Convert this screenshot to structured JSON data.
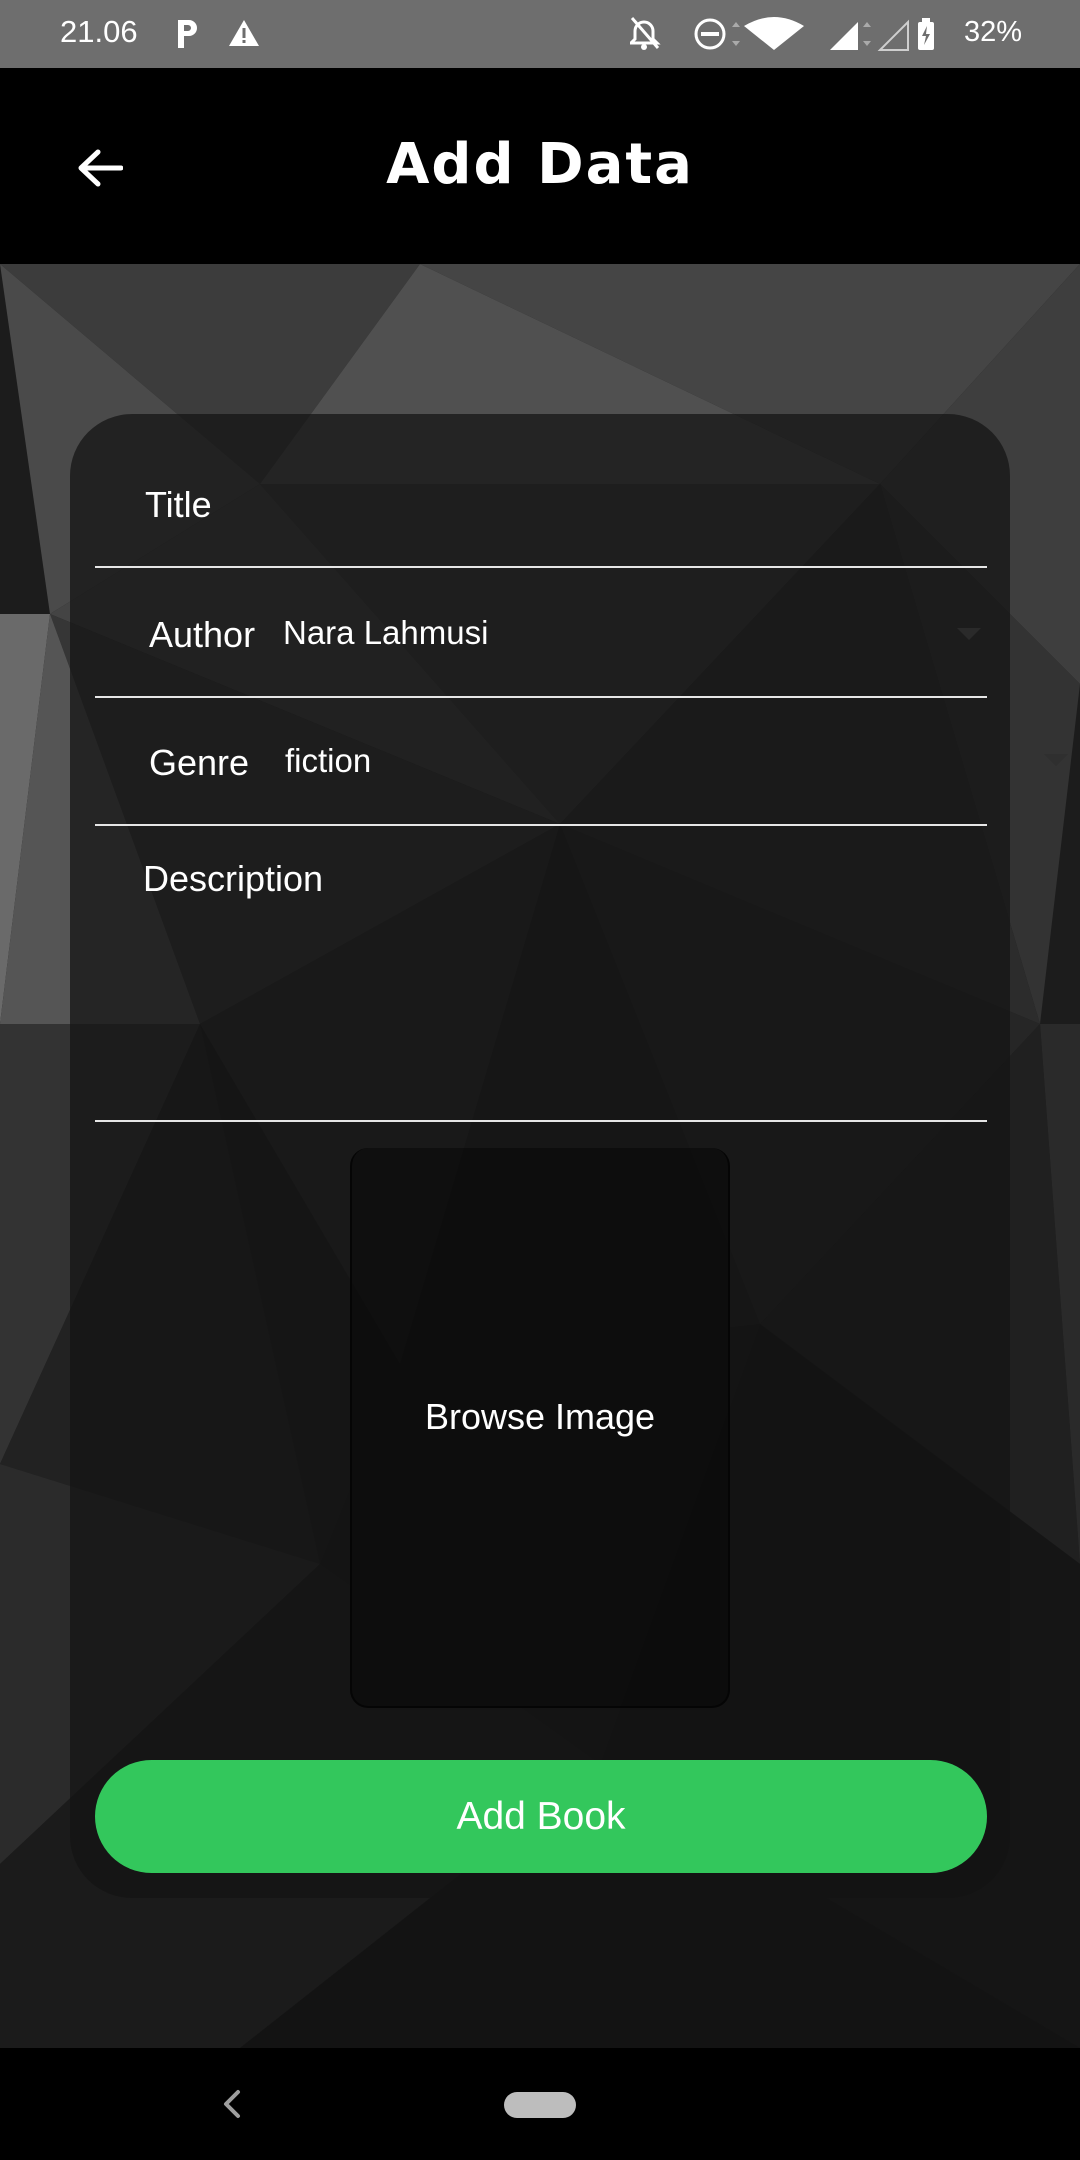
{
  "status_bar": {
    "time": "21.06",
    "battery_percent": "32%",
    "icons": [
      "parking-app-icon",
      "warning-icon",
      "notifications-off-icon",
      "do-not-disturb-icon",
      "wifi-icon",
      "signal-icon",
      "signal-empty-icon",
      "battery-charging-icon"
    ]
  },
  "app_bar": {
    "title": "Add Data",
    "back_icon": "arrow-left-icon"
  },
  "form": {
    "title_label": "Title",
    "author_label": "Author",
    "author_value": "Nara Lahmusi",
    "genre_label": "Genre",
    "genre_value": "fiction",
    "description_label": "Description",
    "browse_image_label": "Browse Image",
    "submit_label": "Add Book"
  },
  "colors": {
    "accent": "#33c75c",
    "background": "#1a1a1a",
    "app_bar": "#000000",
    "status_bar": "#6e6e6e"
  },
  "nav_bar": {
    "icons": [
      "nav-back-icon",
      "nav-home-pill"
    ]
  }
}
